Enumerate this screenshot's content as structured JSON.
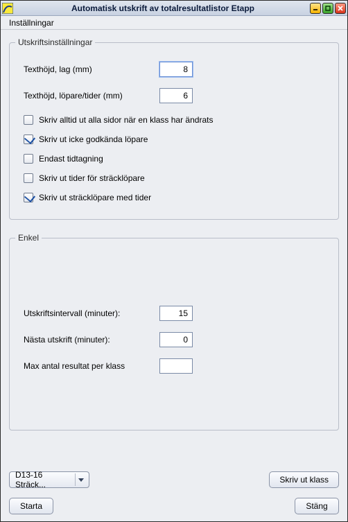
{
  "window": {
    "title": "Automatisk utskrift av totalresultatlistor Etapp"
  },
  "menubar": {
    "settings": "Inställningar"
  },
  "group_print": {
    "legend": "Utskriftsinställningar",
    "text_height_team_label": "Texthöjd, lag (mm)",
    "text_height_team_value": "8",
    "text_height_runner_label": "Texthöjd, löpare/tider (mm)",
    "text_height_runner_value": "6",
    "chk_print_all_label": "Skriv alltid ut alla sidor när en klass har ändrats",
    "chk_print_all_checked": false,
    "chk_print_not_approved_label": "Skriv ut icke godkända löpare",
    "chk_print_not_approved_checked": true,
    "chk_timing_only_label": "Endast tidtagning",
    "chk_timing_only_checked": false,
    "chk_print_times_leg_label": "Skriv ut tider för sträcklöpare",
    "chk_print_times_leg_checked": false,
    "chk_print_leg_with_times_label": "Skriv ut sträcklöpare med tider",
    "chk_print_leg_with_times_checked": true
  },
  "group_simple": {
    "legend": "Enkel",
    "interval_label": "Utskriftsintervall (minuter):",
    "interval_value": "15",
    "next_print_label": "Nästa utskrift (minuter):",
    "next_print_value": "0",
    "max_results_label": "Max antal resultat per klass",
    "max_results_value": ""
  },
  "footer": {
    "class_combo_value": "D13-16 Sträck...",
    "print_class_button": "Skriv ut klass",
    "start_button": "Starta",
    "close_button": "Stäng"
  }
}
